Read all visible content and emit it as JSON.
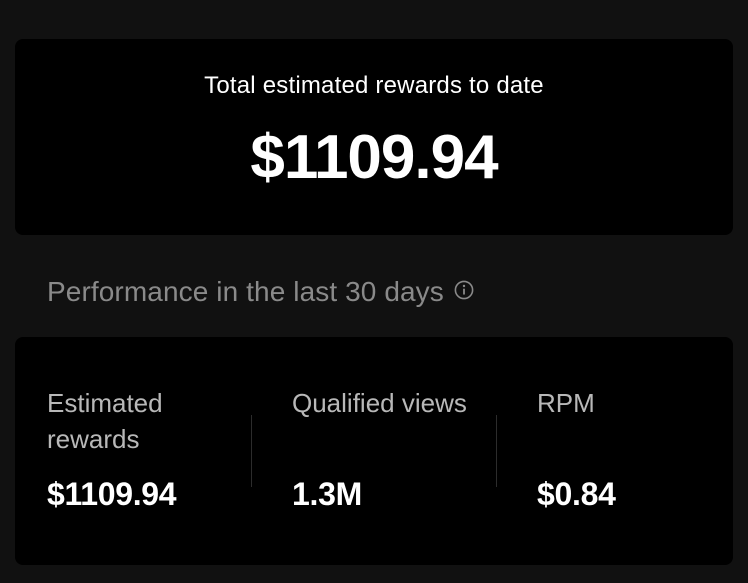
{
  "total": {
    "label": "Total estimated rewards to date",
    "value": "$1109.94"
  },
  "performance": {
    "title": "Performance in the last 30 days",
    "info_icon": "info-icon",
    "stats": [
      {
        "label": "Estimated rewards",
        "value": "$1109.94"
      },
      {
        "label": "Qualified views",
        "value": "1.3M"
      },
      {
        "label": "RPM",
        "value": "$0.84"
      }
    ]
  },
  "colors": {
    "background": "#111111",
    "card": "#000000",
    "title_gray": "#8a8a8a",
    "label_gray": "#b8b8b8",
    "text": "#ffffff"
  }
}
